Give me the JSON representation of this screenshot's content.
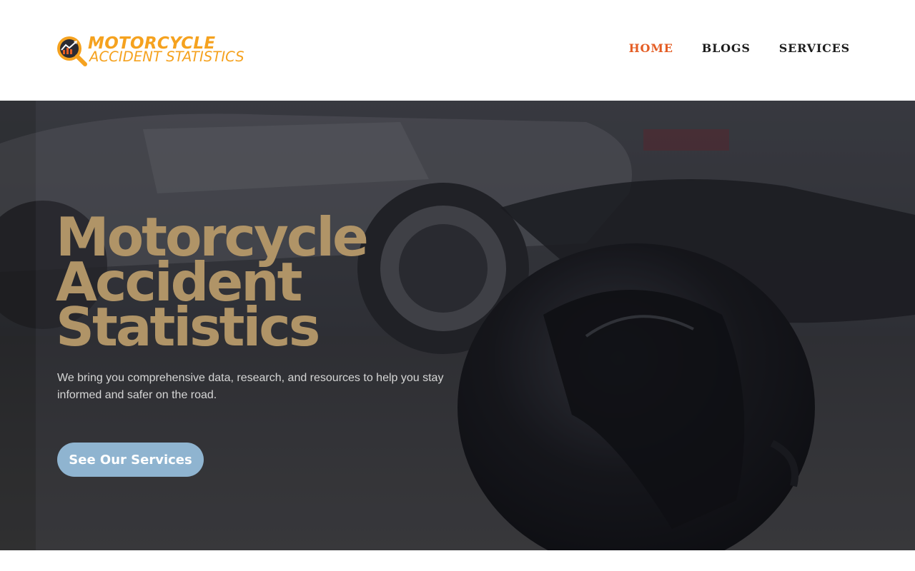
{
  "brand": {
    "line1": "MOTORCYCLE",
    "line2": "ACCIDENT STATISTICS",
    "logo_icon": "chart-magnifier-icon",
    "color": "#f5a21f"
  },
  "nav": {
    "items": [
      {
        "label": "HOME",
        "active": true
      },
      {
        "label": "BLOGS",
        "active": false
      },
      {
        "label": "SERVICES",
        "active": false
      }
    ],
    "active_color": "#e45d24"
  },
  "hero": {
    "title_lines": [
      "Motorcycle",
      "Accident",
      "Statistics"
    ],
    "subtitle": "We bring you comprehensive data, research, and resources to help you stay informed and safer on the road.",
    "button_label": "See Our Services",
    "title_color": "#b09467",
    "button_color": "#8fb4d0"
  }
}
